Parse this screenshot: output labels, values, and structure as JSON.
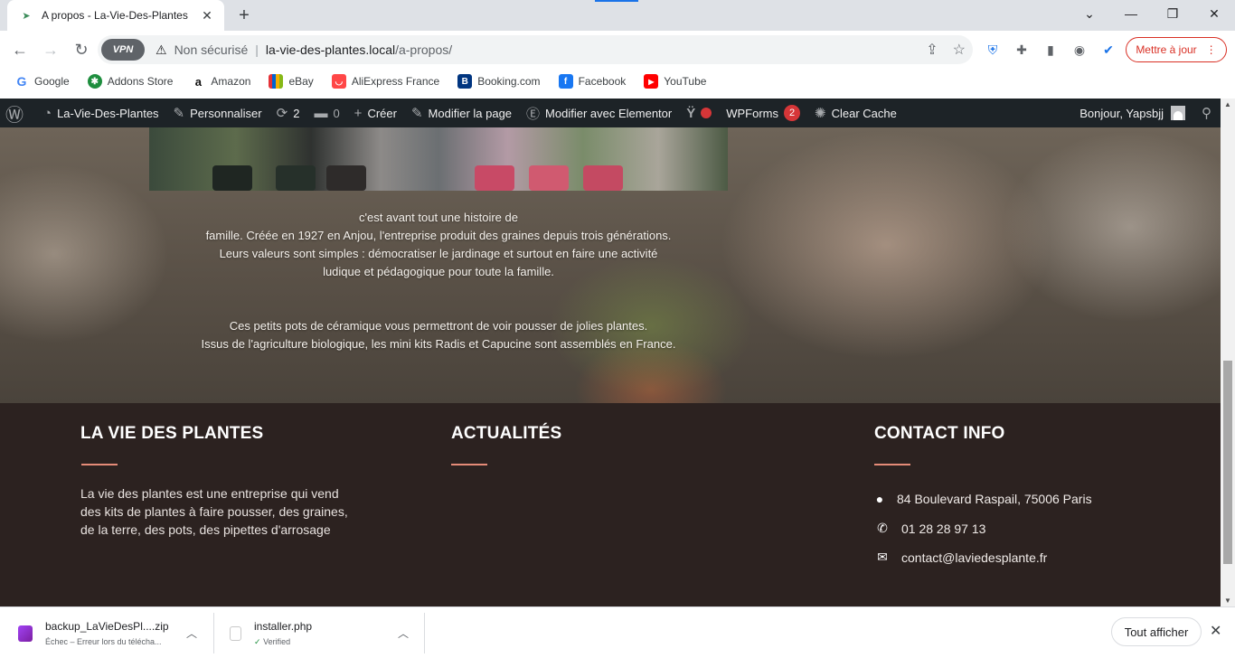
{
  "browser": {
    "tab_title": "A propos - La-Vie-Des-Plantes",
    "url_security": "Non sécurisé",
    "url_host": "la-vie-des-plantes.local",
    "url_path": "/a-propos/",
    "vpn_label": "VPN",
    "update_button": "Mettre à jour"
  },
  "bookmarks": [
    {
      "label": "Google",
      "icon": "google-icon",
      "color": "#4285f4"
    },
    {
      "label": "Addons Store",
      "icon": "addons-store-icon",
      "color": "#1e8e3e"
    },
    {
      "label": "Amazon",
      "icon": "amazon-icon",
      "color": "#111111"
    },
    {
      "label": "eBay",
      "icon": "ebay-icon",
      "color": "#e53238"
    },
    {
      "label": "AliExpress France",
      "icon": "aliexpress-icon",
      "color": "#ff4747"
    },
    {
      "label": "Booking.com",
      "icon": "booking-icon",
      "color": "#003580"
    },
    {
      "label": "Facebook",
      "icon": "facebook-icon",
      "color": "#1877f2"
    },
    {
      "label": "YouTube",
      "icon": "youtube-icon",
      "color": "#ff0000"
    }
  ],
  "wp_admin_bar": {
    "site_name": "La-Vie-Des-Plantes",
    "customize": "Personnaliser",
    "updates_count": "2",
    "comments_count": "0",
    "new": "Créer",
    "edit_page": "Modifier la page",
    "edit_elementor": "Modifier avec Elementor",
    "wpforms": "WPForms",
    "wpforms_badge": "2",
    "clear_cache": "Clear Cache",
    "greeting": "Bonjour, Yapsbjj"
  },
  "about": {
    "paragraph1": [
      "c'est avant tout une histoire de",
      "famille. Créée en 1927 en Anjou, l'entreprise produit des graines depuis trois générations.",
      "Leurs valeurs sont simples : démocratiser le jardinage et surtout en faire une activité",
      "ludique et pédagogique pour toute la famille."
    ],
    "paragraph2": [
      "Ces petits pots de céramique vous permettront de voir pousser de jolies plantes.",
      "Issus de l'agriculture biologique, les mini kits Radis et Capucine sont assemblés en France."
    ]
  },
  "footer": {
    "col1_title": "LA VIE DES PLANTES",
    "col1_text": "La vie des plantes est une entreprise qui vend des kits de plantes à faire pousser, des graines, de la terre, des pots, des pipettes d'arrosage",
    "col2_title": "ACTUALITÉS",
    "col3_title": "CONTACT INFO",
    "address": "84 Boulevard Raspail, 75006 Paris",
    "phone": "01 28 28 97 13",
    "email": "contact@laviedesplante.fr",
    "accent_color": "#e58b78"
  },
  "downloads": {
    "item1_name": "backup_LaVieDesPl....zip",
    "item1_status": "Échec – Erreur lors du téléchа...",
    "item2_name": "installer.php",
    "item2_status": "Verified",
    "show_all": "Tout afficher"
  }
}
